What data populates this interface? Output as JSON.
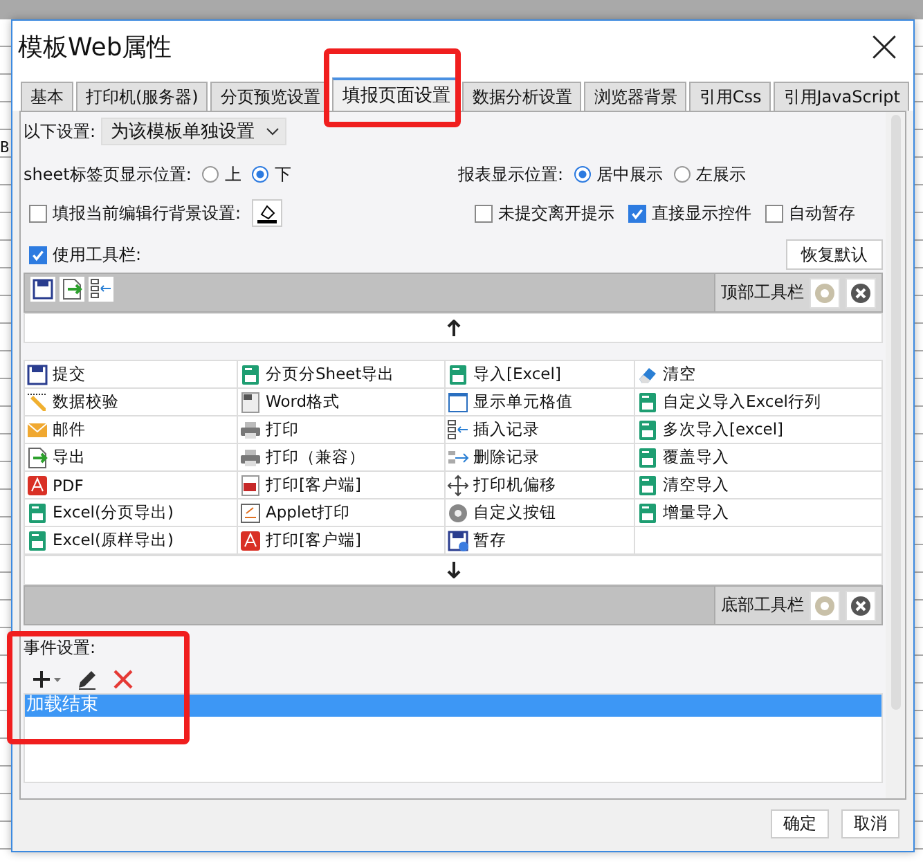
{
  "backdrop": {
    "text": "B"
  },
  "window": {
    "title": "模板Web属性"
  },
  "tabs": [
    {
      "label": "基本",
      "selected": false,
      "highlight": false
    },
    {
      "label": "打印机(服务器)",
      "selected": false,
      "highlight": false
    },
    {
      "label": "分页预览设置",
      "selected": false,
      "highlight": false
    },
    {
      "label": "填报页面设置",
      "selected": true,
      "highlight": true
    },
    {
      "label": "数据分析设置",
      "selected": false,
      "highlight": false
    },
    {
      "label": "浏览器背景",
      "selected": false,
      "highlight": false
    },
    {
      "label": "引用Css",
      "selected": false,
      "highlight": false
    },
    {
      "label": "引用JavaScript",
      "selected": false,
      "highlight": false
    }
  ],
  "settings_scope": {
    "label": "以下设置:",
    "value": "为该模板单独设置"
  },
  "sheet_tab_position": {
    "label": "sheet标签页显示位置:",
    "options": [
      {
        "label": "上",
        "selected": false
      },
      {
        "label": "下",
        "selected": true
      }
    ]
  },
  "report_position": {
    "label": "报表显示位置:",
    "options": [
      {
        "label": "居中展示",
        "selected": true
      },
      {
        "label": "左展示",
        "selected": false
      }
    ]
  },
  "row_background": {
    "label": "填报当前编辑行背景设置:",
    "checked": false
  },
  "options": [
    {
      "label": "未提交离开提示",
      "checked": false
    },
    {
      "label": "直接显示控件",
      "checked": true
    },
    {
      "label": "自动暂存",
      "checked": false
    }
  ],
  "use_toolbar": {
    "label": "使用工具栏:",
    "checked": true
  },
  "restore_default_button": "恢复默认",
  "top_toolbar": {
    "label": "顶部工具栏",
    "icons": [
      {
        "kind": "save"
      },
      {
        "kind": "export"
      },
      {
        "kind": "insert"
      }
    ]
  },
  "buttons_grid": [
    {
      "label": "提交",
      "kind": "save"
    },
    {
      "label": "分页分Sheet导出",
      "kind": "excel"
    },
    {
      "label": "导入[Excel]",
      "kind": "excel"
    },
    {
      "label": "清空",
      "kind": "eraser"
    },
    {
      "label": "数据校验",
      "kind": "verify"
    },
    {
      "label": "Word格式",
      "kind": "word"
    },
    {
      "label": "显示单元格值",
      "kind": "cell"
    },
    {
      "label": "自定义导入Excel行列",
      "kind": "excel"
    },
    {
      "label": "邮件",
      "kind": "mail"
    },
    {
      "label": "打印",
      "kind": "printer"
    },
    {
      "label": "插入记录",
      "kind": "insert"
    },
    {
      "label": "多次导入[excel]",
      "kind": "excel"
    },
    {
      "label": "导出",
      "kind": "export"
    },
    {
      "label": "打印（兼容）",
      "kind": "printer"
    },
    {
      "label": "删除记录",
      "kind": "delete"
    },
    {
      "label": "覆盖导入",
      "kind": "excel"
    },
    {
      "label": "PDF",
      "kind": "pdf"
    },
    {
      "label": "打印[客户端]",
      "kind": "flash"
    },
    {
      "label": "打印机偏移",
      "kind": "move"
    },
    {
      "label": "清空导入",
      "kind": "excel"
    },
    {
      "label": "Excel(分页导出)",
      "kind": "excel"
    },
    {
      "label": "Applet打印",
      "kind": "applet"
    },
    {
      "label": "自定义按钮",
      "kind": "gear"
    },
    {
      "label": "增量导入",
      "kind": "excel"
    },
    {
      "label": "Excel(原样导出)",
      "kind": "excel"
    },
    {
      "label": "打印[客户端]",
      "kind": "pdf"
    },
    {
      "label": "暂存",
      "kind": "savetime"
    }
  ],
  "bottom_toolbar": {
    "label": "底部工具栏"
  },
  "events": {
    "label": "事件设置:",
    "highlight": true,
    "items": [
      {
        "label": "加载结束",
        "selected": true
      }
    ]
  },
  "footer_buttons": [
    "确定",
    "取消"
  ]
}
